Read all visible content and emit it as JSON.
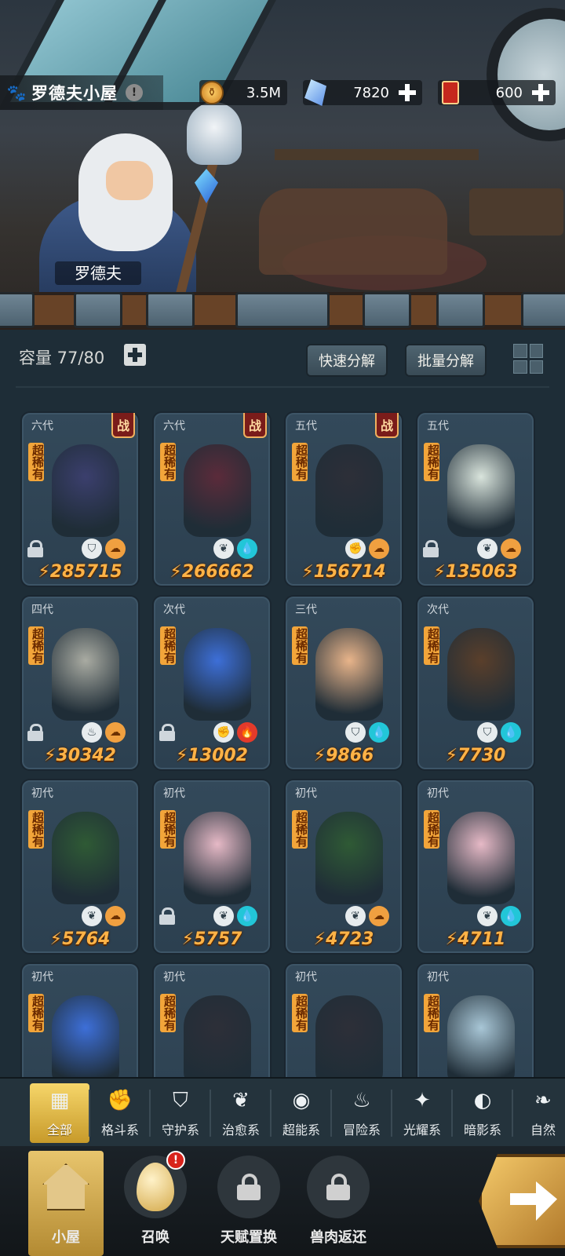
{
  "header": {
    "house_title": "罗德夫小屋",
    "info_icon": "!",
    "npc_name": "罗德夫",
    "resources": [
      {
        "icon": "coin-icon",
        "value": "3.5M"
      },
      {
        "icon": "crystal-icon",
        "value": "7820"
      },
      {
        "icon": "ticket-icon",
        "value": "600"
      }
    ]
  },
  "toolbar": {
    "capacity_label": "容量 77/80",
    "quick_decompose": "快速分解",
    "batch_decompose": "批量分解"
  },
  "fight_badge": "战",
  "rarity_label": "超稀有",
  "pets": [
    {
      "gen": "六代",
      "power": "285715",
      "fight": true,
      "locked": true,
      "types": [
        "guard",
        "orange"
      ],
      "color": "#3b3f6d"
    },
    {
      "gen": "六代",
      "power": "266662",
      "fight": true,
      "locked": false,
      "types": [
        "heal",
        "teal"
      ],
      "color": "#5b2b3a"
    },
    {
      "gen": "五代",
      "power": "156714",
      "fight": true,
      "locked": false,
      "types": [
        "fist",
        "orange"
      ],
      "color": "#2d2f38"
    },
    {
      "gen": "五代",
      "power": "135063",
      "fight": false,
      "locked": true,
      "types": [
        "heal",
        "orange"
      ],
      "color": "#d9e4dc"
    },
    {
      "gen": "四代",
      "power": "30342",
      "fight": false,
      "locked": true,
      "types": [
        "adventure",
        "orange"
      ],
      "color": "#a9aba2"
    },
    {
      "gen": "次代",
      "power": "13002",
      "fight": false,
      "locked": true,
      "types": [
        "fist",
        "red"
      ],
      "color": "#3d6fd8"
    },
    {
      "gen": "三代",
      "power": "9866",
      "fight": false,
      "locked": false,
      "types": [
        "guard",
        "teal"
      ],
      "color": "#e8b48a"
    },
    {
      "gen": "次代",
      "power": "7730",
      "fight": false,
      "locked": false,
      "types": [
        "guard",
        "teal"
      ],
      "color": "#5a3f2b"
    },
    {
      "gen": "初代",
      "power": "5764",
      "fight": false,
      "locked": false,
      "types": [
        "heal",
        "orange"
      ],
      "color": "#2f5a35"
    },
    {
      "gen": "初代",
      "power": "5757",
      "fight": false,
      "locked": true,
      "types": [
        "heal",
        "teal"
      ],
      "color": "#e6b9c6"
    },
    {
      "gen": "初代",
      "power": "4723",
      "fight": false,
      "locked": false,
      "types": [
        "heal",
        "orange"
      ],
      "color": "#2f5a35"
    },
    {
      "gen": "初代",
      "power": "4711",
      "fight": false,
      "locked": false,
      "types": [
        "heal",
        "teal"
      ],
      "color": "#e6b9c6"
    },
    {
      "gen": "初代",
      "power": "",
      "fight": false,
      "locked": false,
      "types": [],
      "color": "#3d6fd8"
    },
    {
      "gen": "初代",
      "power": "",
      "fight": false,
      "locked": false,
      "types": [],
      "color": "#2d2f38"
    },
    {
      "gen": "初代",
      "power": "",
      "fight": false,
      "locked": false,
      "types": [],
      "color": "#2d2f38"
    },
    {
      "gen": "初代",
      "power": "",
      "fight": false,
      "locked": false,
      "types": [],
      "color": "#a8c6d6"
    }
  ],
  "categories": [
    {
      "label": "全部",
      "icon": "all-icon",
      "glyph": "▦"
    },
    {
      "label": "格斗系",
      "icon": "fist-icon",
      "glyph": "✊"
    },
    {
      "label": "守护系",
      "icon": "shield-icon",
      "glyph": "⛉"
    },
    {
      "label": "治愈系",
      "icon": "sprout-icon",
      "glyph": "❦"
    },
    {
      "label": "超能系",
      "icon": "alien-icon",
      "glyph": "◉"
    },
    {
      "label": "冒险系",
      "icon": "lantern-icon",
      "glyph": "♨"
    },
    {
      "label": "光耀系",
      "icon": "sparkle-icon",
      "glyph": "✦"
    },
    {
      "label": "暗影系",
      "icon": "eclipse-icon",
      "glyph": "◐"
    },
    {
      "label": "自然",
      "icon": "leaf-icon",
      "glyph": "❧"
    }
  ],
  "bottom_nav": [
    {
      "label": "小屋",
      "icon": "house-icon"
    },
    {
      "label": "召唤",
      "icon": "egg-icon",
      "alert": "!"
    },
    {
      "label": "天赋置换",
      "icon": "lock-icon"
    },
    {
      "label": "兽肉返还",
      "icon": "lock-icon"
    }
  ]
}
